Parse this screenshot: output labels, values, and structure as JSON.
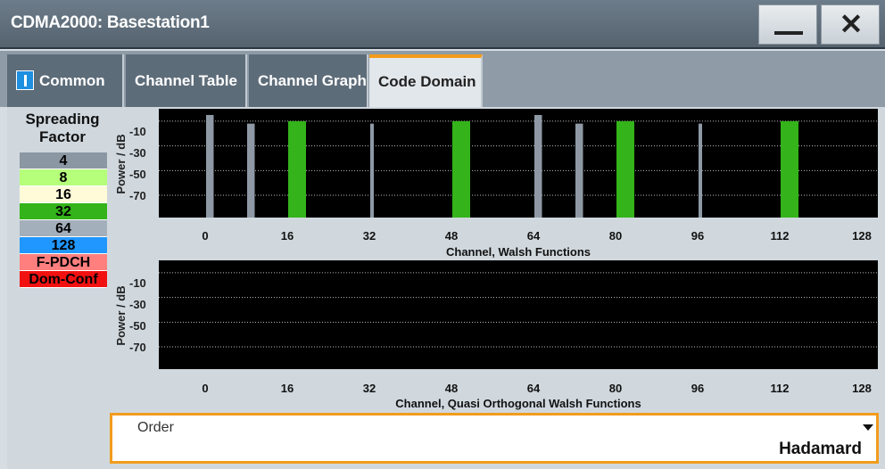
{
  "window": {
    "title": "CDMA2000: Basestation1",
    "minimize_icon": "minimize-icon",
    "close_symbol": "✕"
  },
  "tabs": [
    {
      "label": "Common",
      "icon": "info-icon"
    },
    {
      "label": "Channel Table"
    },
    {
      "label": "Channel Graph"
    },
    {
      "label": "Code Domain",
      "active": true
    }
  ],
  "legend": {
    "title": "Spreading Factor",
    "items": [
      {
        "label": "4",
        "color": "#8b97a3"
      },
      {
        "label": "8",
        "color": "#b5ff7a"
      },
      {
        "label": "16",
        "color": "#fffbd9"
      },
      {
        "label": "32",
        "color": "#34b31a"
      },
      {
        "label": "64",
        "color": "#a3afba"
      },
      {
        "label": "128",
        "color": "#1f97ff"
      },
      {
        "label": "F-PDCH",
        "color": "#ff7f7f"
      },
      {
        "label": "Dom-Conf",
        "color": "#f21111"
      }
    ]
  },
  "chart_data": [
    {
      "type": "bar",
      "ylabel": "Power / dB",
      "yticks": [
        "-10",
        "-30",
        "-50",
        "-70"
      ],
      "xlabel": "Channel, Walsh Functions",
      "xticks": [
        "0",
        "16",
        "32",
        "48",
        "64",
        "80",
        "96",
        "112",
        "128"
      ],
      "xlim": [
        0,
        128
      ],
      "ylim": [
        -88,
        0
      ],
      "grid": true,
      "bars": [
        {
          "channel": 0,
          "width": 2,
          "power": -5,
          "color": "#8e99a5"
        },
        {
          "channel": 8,
          "width": 2,
          "power": -12,
          "color": "#8e99a5"
        },
        {
          "channel": 16,
          "width": 4,
          "power": -10,
          "color": "#34b31a"
        },
        {
          "channel": 32,
          "width": 1,
          "power": -12,
          "color": "#8e99a5"
        },
        {
          "channel": 48,
          "width": 4,
          "power": -10,
          "color": "#34b31a"
        },
        {
          "channel": 64,
          "width": 2,
          "power": -5,
          "color": "#8e99a5"
        },
        {
          "channel": 72,
          "width": 2,
          "power": -12,
          "color": "#8e99a5"
        },
        {
          "channel": 80,
          "width": 4,
          "power": -10,
          "color": "#34b31a"
        },
        {
          "channel": 96,
          "width": 1,
          "power": -12,
          "color": "#8e99a5"
        },
        {
          "channel": 112,
          "width": 4,
          "power": -10,
          "color": "#34b31a"
        }
      ]
    },
    {
      "type": "bar",
      "ylabel": "Power / dB",
      "yticks": [
        "-10",
        "-30",
        "-50",
        "-70"
      ],
      "xlabel": "Channel, Quasi Orthogonal Walsh Functions",
      "xticks": [
        "0",
        "16",
        "32",
        "48",
        "64",
        "80",
        "96",
        "112",
        "128"
      ],
      "xlim": [
        0,
        128
      ],
      "ylim": [
        -88,
        0
      ],
      "grid": true,
      "bars": []
    }
  ],
  "order": {
    "label": "Order",
    "value": "Hadamard"
  }
}
